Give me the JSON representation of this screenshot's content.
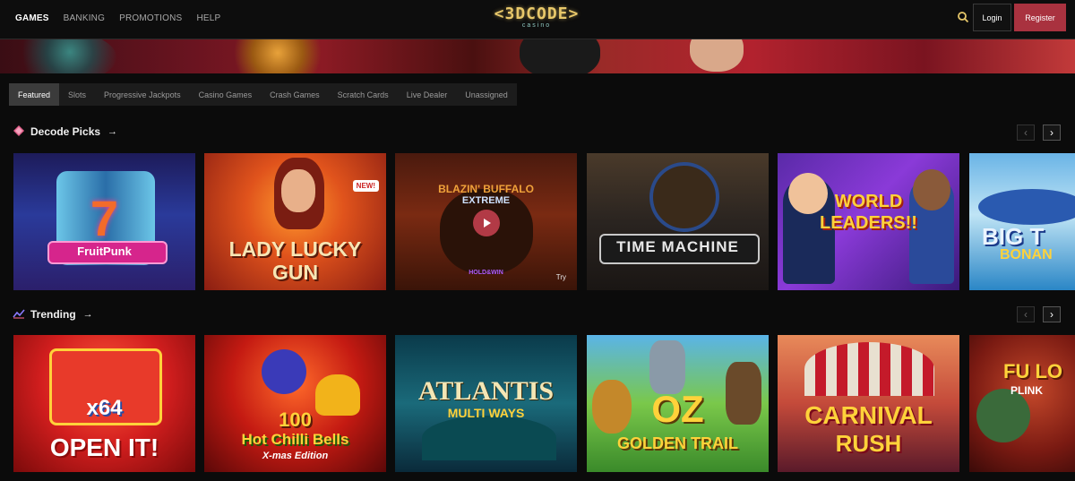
{
  "nav": {
    "items": [
      "GAMES",
      "BANKING",
      "PROMOTIONS",
      "HELP"
    ],
    "active": "GAMES"
  },
  "logo": {
    "main": "<3DCODE>",
    "sub": "casino"
  },
  "auth": {
    "login": "Login",
    "register": "Register"
  },
  "categories": [
    "Featured",
    "Slots",
    "Progressive Jackpots",
    "Casino Games",
    "Crash Games",
    "Scratch Cards",
    "Live Dealer",
    "Unassigned"
  ],
  "sections": {
    "picks": {
      "title": "Decode Picks",
      "icon": "diamond-icon",
      "arrow": "→"
    },
    "trending": {
      "title": "Trending",
      "icon": "trending-chart-icon",
      "arrow": "→"
    }
  },
  "pager": {
    "prev": "‹",
    "next": "›"
  },
  "picks_games": [
    {
      "name": "FruitPunk",
      "badge": "7"
    },
    {
      "name": "LADY LUCKY",
      "name2": "GUN",
      "badge": "NEW!"
    },
    {
      "name": "BLAZIN' BUFFALO",
      "name2": "EXTREME",
      "tag": "HOLD&WIN",
      "try": "Try"
    },
    {
      "name": "TIME MACHINE"
    },
    {
      "name": "WORLD",
      "name2": "LEADERS!!"
    },
    {
      "name": "BIG T",
      "name2": "BONAN"
    }
  ],
  "trending_games": [
    {
      "name": "OPEN IT!",
      "badge": "x64"
    },
    {
      "name": "100",
      "name2": "Hot Chilli Bells",
      "name3": "X-mas Edition"
    },
    {
      "name": "ATLANTIS",
      "name2": "MULTI WAYS"
    },
    {
      "name": "OZ",
      "name2": "GOLDEN TRAIL"
    },
    {
      "name": "CARNIVAL",
      "name2": "RUSH"
    },
    {
      "name": "FU LO",
      "name2": "PLINK"
    }
  ],
  "colors": {
    "accent": "#a9323f",
    "background": "#0b0b0b",
    "logo_gold": "#e8c86a"
  }
}
